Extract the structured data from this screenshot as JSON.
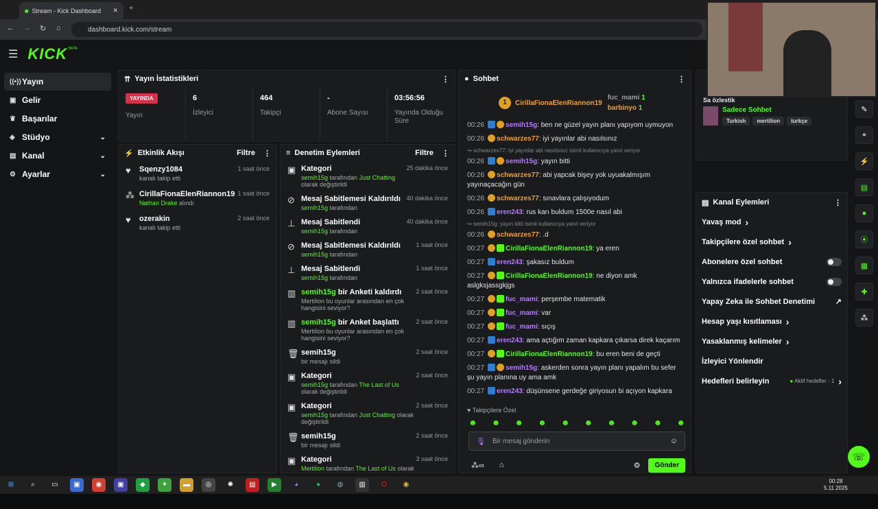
{
  "browser": {
    "tab_title": "Stream - Kick Dashboard",
    "url": "dashboard.kick.com/stream"
  },
  "brand": {
    "logo": "KICK",
    "beta": "BETA"
  },
  "sidebar": [
    {
      "icon": "broadcast-icon",
      "label": "Yayın",
      "active": true
    },
    {
      "icon": "dollar-icon",
      "label": "Gelir"
    },
    {
      "icon": "trophy-icon",
      "label": "Başarılar"
    },
    {
      "icon": "studio-icon",
      "label": "Stüdyo",
      "chev": true
    },
    {
      "icon": "channel-icon",
      "label": "Kanal",
      "chev": true
    },
    {
      "icon": "gear-icon",
      "label": "Ayarlar",
      "chev": true
    }
  ],
  "stats": {
    "title": "Yayın İstatistikleri",
    "live_badge": "YAYINDA",
    "live_label": "Yayın",
    "items": [
      {
        "value": "6",
        "label": "İzleyici"
      },
      {
        "value": "464",
        "label": "Takipçi"
      },
      {
        "value": "-",
        "label": "Abone Sayısı"
      },
      {
        "value": "03:56:56",
        "label": "Yayında Olduğu Süre"
      }
    ]
  },
  "activity": {
    "title": "Etkinlik Akışı",
    "filter": "Filtre",
    "items": [
      {
        "title": "Sqenzy1084",
        "sub": "kanalı takip etti",
        "time": "1 saat önce"
      },
      {
        "title": "CirillaFionaElenRiannon19",
        "sub_green": "Nathan Drake",
        "sub": " alındı",
        "time": "1 saat önce"
      },
      {
        "title": "ozerakin",
        "sub": "kanalı takip etti",
        "time": "2 saat önce"
      }
    ]
  },
  "moderation": {
    "title": "Denetim Eylemleri",
    "filter": "Filtre",
    "items": [
      {
        "icon": "tv",
        "title": "Kategori",
        "user": "semih15g",
        "mid": " tarafından ",
        "cat": "Just Chatting",
        "end": " olarak değiştirildi",
        "time": "25 dakika önce"
      },
      {
        "icon": "unpin",
        "title": "Mesaj Sabitlemesi Kaldırıldı",
        "user": "semih15g",
        "mid": " tarafından",
        "time": "40 dakika önce"
      },
      {
        "icon": "pin",
        "title": "Mesaj Sabitlendi",
        "user": "semih15g",
        "mid": " tarafından",
        "time": "40 dakika önce"
      },
      {
        "icon": "unpin",
        "title": "Mesaj Sabitlemesi Kaldırıldı",
        "user": "semih15g",
        "mid": " tarafından",
        "time": "1 saat önce"
      },
      {
        "icon": "pin",
        "title": "Mesaj Sabitlendi",
        "user": "semih15g",
        "mid": " tarafından",
        "time": "1 saat önce"
      },
      {
        "icon": "poll",
        "title_green": "semih15g",
        "title": " bir Anketi kaldırdı",
        "desc": "Mertilion bu oyunlar arasından en çok hangisini seviyor?",
        "time": "2 saat önce"
      },
      {
        "icon": "poll",
        "title_green": "semih15g",
        "title": " bir Anket başlattı",
        "desc": "Mertilion bu oyunlar arasından en çok hangisini seviyor?",
        "time": "2 saat önce"
      },
      {
        "icon": "trash",
        "title": "semih15g",
        "desc": "bir mesajı sildi",
        "time": "2 saat önce"
      },
      {
        "icon": "tv",
        "title": "Kategori",
        "user": "semih15g",
        "mid": " tarafından ",
        "cat": "The Last of Us",
        "end": " olarak değiştirildi",
        "time": "2 saat önce"
      },
      {
        "icon": "tv",
        "title": "Kategori",
        "user": "semih15g",
        "mid": " tarafından ",
        "cat": "Just Chatting",
        "end": " olarak değiştirildi",
        "time": "2 saat önce"
      },
      {
        "icon": "trash",
        "title": "semih15g",
        "desc": "bir mesajı sildi",
        "time": "2 saat önce"
      },
      {
        "icon": "tv",
        "title": "Kategori",
        "user": "Mertilion",
        "mid": " tarafından ",
        "cat": "The Last of Us",
        "end": " olarak değiştirildi",
        "time": "3 saat önce"
      }
    ]
  },
  "chat": {
    "title": "Sohbet",
    "top": [
      {
        "rank": "1",
        "name": "CirillaFionaElenRiannon19",
        "count": ""
      },
      {
        "rank": "",
        "name": "fuc_mami",
        "count": "1"
      },
      {
        "rank": "",
        "name": "barbinyo",
        "count": "1"
      }
    ],
    "messages": [
      {
        "t": "00:26",
        "b": [
          "bl",
          "or"
        ],
        "u": "semih15g",
        "c": "purple",
        "m": ": ben ne güzel yayın planı yapıyom uymuyon"
      },
      {
        "t": "00:26",
        "b": [
          "or"
        ],
        "u": "schwarzes77",
        "c": "orange",
        "m": ": iyi yayınlar abi nasılsınız"
      },
      {
        "sys": "↪ schwarzes77: iyi yayınlar abi nasılsınız isimli kullanıcıya yanıt veriyor"
      },
      {
        "t": "00:26",
        "b": [
          "bl",
          "or"
        ],
        "u": "semih15g",
        "c": "purple",
        "m": ": yayın bitti"
      },
      {
        "t": "00:26",
        "b": [
          "or"
        ],
        "u": "schwarzes77",
        "c": "orange",
        "m": ": abi yapcak bişey yok uyuakalmışım yayınaçacağın gün"
      },
      {
        "t": "00:26",
        "b": [
          "or"
        ],
        "u": "schwarzes77",
        "c": "orange",
        "m": ": sınavlara çalışıyodum"
      },
      {
        "t": "00:26",
        "b": [
          "bl"
        ],
        "u": "eren243",
        "c": "purple",
        "m": ": rus karı buldum 1500e nasıl abi"
      },
      {
        "sys": "↪ semih15g: yayın bitti isimli kullanıcıya yanıt veriyor"
      },
      {
        "t": "00:26",
        "b": [
          "or"
        ],
        "u": "schwarzes77",
        "c": "orange",
        "m": ": .d"
      },
      {
        "t": "00:27",
        "b": [
          "or",
          "gr"
        ],
        "u": "CirillaFionaElenRiannon19",
        "c": "green",
        "m": ": ya eren"
      },
      {
        "t": "00:27",
        "b": [
          "bl"
        ],
        "u": "eren243",
        "c": "purple",
        "m": ": şakasız buldum"
      },
      {
        "t": "00:27",
        "b": [
          "or",
          "gr"
        ],
        "u": "CirillaFionaElenRiannon19",
        "c": "green",
        "m": ": ne diyon amk aslgksjassgkjgs"
      },
      {
        "t": "00:27",
        "b": [
          "or",
          "gr"
        ],
        "u": "fuc_mami",
        "c": "purple",
        "m": ": perşembe matematik"
      },
      {
        "t": "00:27",
        "b": [
          "or",
          "gr"
        ],
        "u": "fuc_mami",
        "c": "purple",
        "m": ": var"
      },
      {
        "t": "00:27",
        "b": [
          "or",
          "gr"
        ],
        "u": "fuc_mami",
        "c": "purple",
        "m": ": sıçış"
      },
      {
        "t": "00:27",
        "b": [
          "bl"
        ],
        "u": "eren243",
        "c": "purple",
        "m": ": ama açtığım zaman kapkara çıkarsa direk kaçarım"
      },
      {
        "t": "00:27",
        "b": [
          "or",
          "gr"
        ],
        "u": "CirillaFionaElenRiannon19",
        "c": "green",
        "m": ": bu eren beni de geçti"
      },
      {
        "t": "00:27",
        "b": [
          "bl",
          "or"
        ],
        "u": "semih15g",
        "c": "purple",
        "m": ": askerden sonra yayın planı yapalım bu sefer şu yayın planına uy ama amk"
      },
      {
        "t": "00:27",
        "b": [
          "bl"
        ],
        "u": "eren243",
        "c": "purple",
        "m": ": düşünsene gerdeğe giriyosun bi açıyon kapkara"
      }
    ],
    "followers_only": "Takipçilere Özel",
    "placeholder": "Bir mesaj gönderin",
    "send": "Gönder"
  },
  "right": {
    "partial_title": "Sa özlestik",
    "featured": "Sadece Sohbet",
    "tags": [
      "Turkish",
      "mertilion",
      "turkçe"
    ],
    "actions_title": "Kanal Eylemleri",
    "actions": [
      {
        "label": "Yavaş mod",
        "type": "chev"
      },
      {
        "label": "Takipçilere özel sohbet",
        "type": "chev"
      },
      {
        "label": "Abonelere özel sohbet",
        "type": "toggle"
      },
      {
        "label": "Yalnızca ifadelerle sohbet",
        "type": "toggle"
      },
      {
        "label": "Yapay Zeka ile Sohbet Denetimi",
        "type": "ext"
      },
      {
        "label": "Hesap yaşı kısıtlaması",
        "type": "chev"
      },
      {
        "label": "Yasaklanmış kelimeler",
        "type": "chev"
      },
      {
        "label": "İzleyici Yönlendir",
        "type": "none"
      },
      {
        "label": "Hedefleri belirleyin",
        "type": "chev",
        "extra": "Aktif hedefler - 1"
      }
    ]
  },
  "taskbar": {
    "time": "00:28",
    "date": "5.11.2025"
  }
}
